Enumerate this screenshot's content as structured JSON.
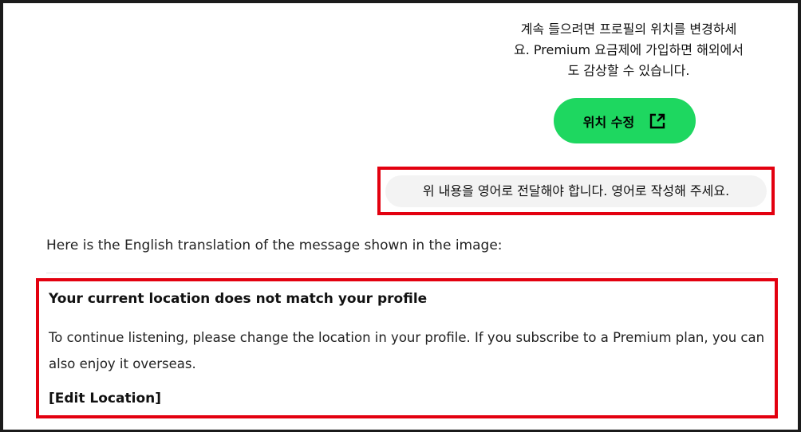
{
  "message": {
    "korean_text": "계속 들으려면 프로필의 위치를 변경하세\n요. Premium 요금제에 가입하면 해외에서\n도 감상할 수 있습니다.",
    "edit_button_label": "위치 수정",
    "edit_button_icon": "external-link-icon",
    "accent_color": "#1ed760"
  },
  "user_message": {
    "text": "위 내용을 영어로 전달해야 합니다. 영어로 작성해 주세요."
  },
  "reply": {
    "intro": "Here is the English translation of the message shown in the image:",
    "title": "Your current location does not match your profile",
    "body": "To continue listening, please change the location in your profile. If you subscribe to a Premium plan, you can also enjoy it overseas.",
    "link": "[Edit Location]"
  },
  "highlight_color": "#e3000f"
}
